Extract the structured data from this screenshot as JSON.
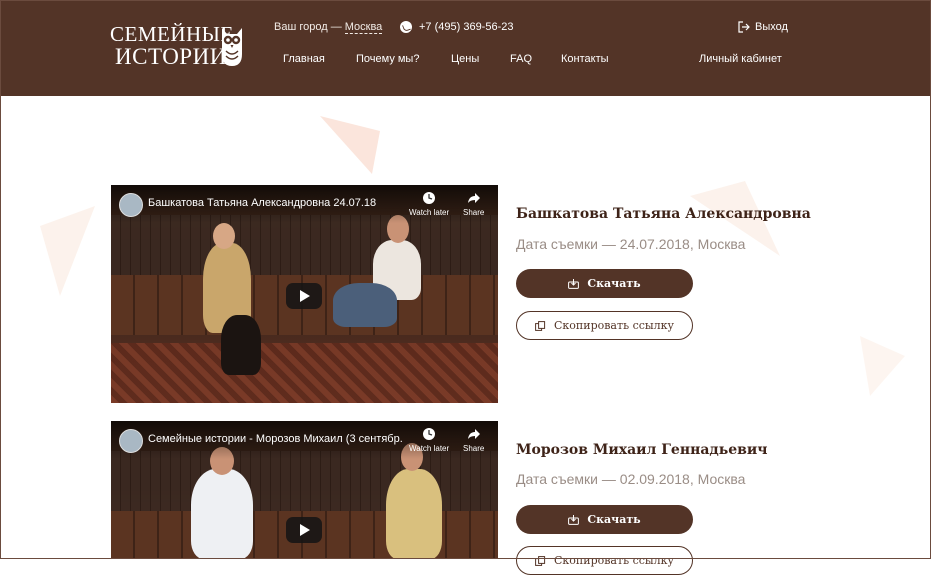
{
  "header": {
    "logo": {
      "line1": "СЕМЕЙНЫЕ",
      "line2": "ИСТОРИИ"
    },
    "city_label": "Ваш город — ",
    "city_value": "Москва",
    "phone": "+7 (495) 369-56-23",
    "logout": "Выход",
    "nav": [
      "Главная",
      "Почему мы?",
      "Цены",
      "FAQ",
      "Контакты"
    ],
    "cabinet": "Личный кабинет"
  },
  "colors": {
    "brand": "#533427",
    "name_text": "#3e2318",
    "date_text": "#9a8d86"
  },
  "icons": {
    "phone": "phone-icon",
    "logout": "logout-icon",
    "download": "download-icon",
    "copy": "copy-icon",
    "owl": "owl-icon"
  },
  "youtube": {
    "watch_later": "Watch later",
    "share": "Share"
  },
  "videos": [
    {
      "title": "Башкатова Татьяна Александровна 24.07.18",
      "name": "Башкатова Татьяна Александровна",
      "date": "Дата съемки — 24.07.2018, Москва",
      "download": "Скачать",
      "copy": "Скопировать ссылку"
    },
    {
      "title": "Семейные истории - Морозов Михаил (3 сентябр...",
      "name": "Морозов Михаил Геннадьевич",
      "date": "Дата съемки — 02.09.2018, Москва",
      "download": "Скачать",
      "copy": "Скопировать ссылку"
    }
  ]
}
